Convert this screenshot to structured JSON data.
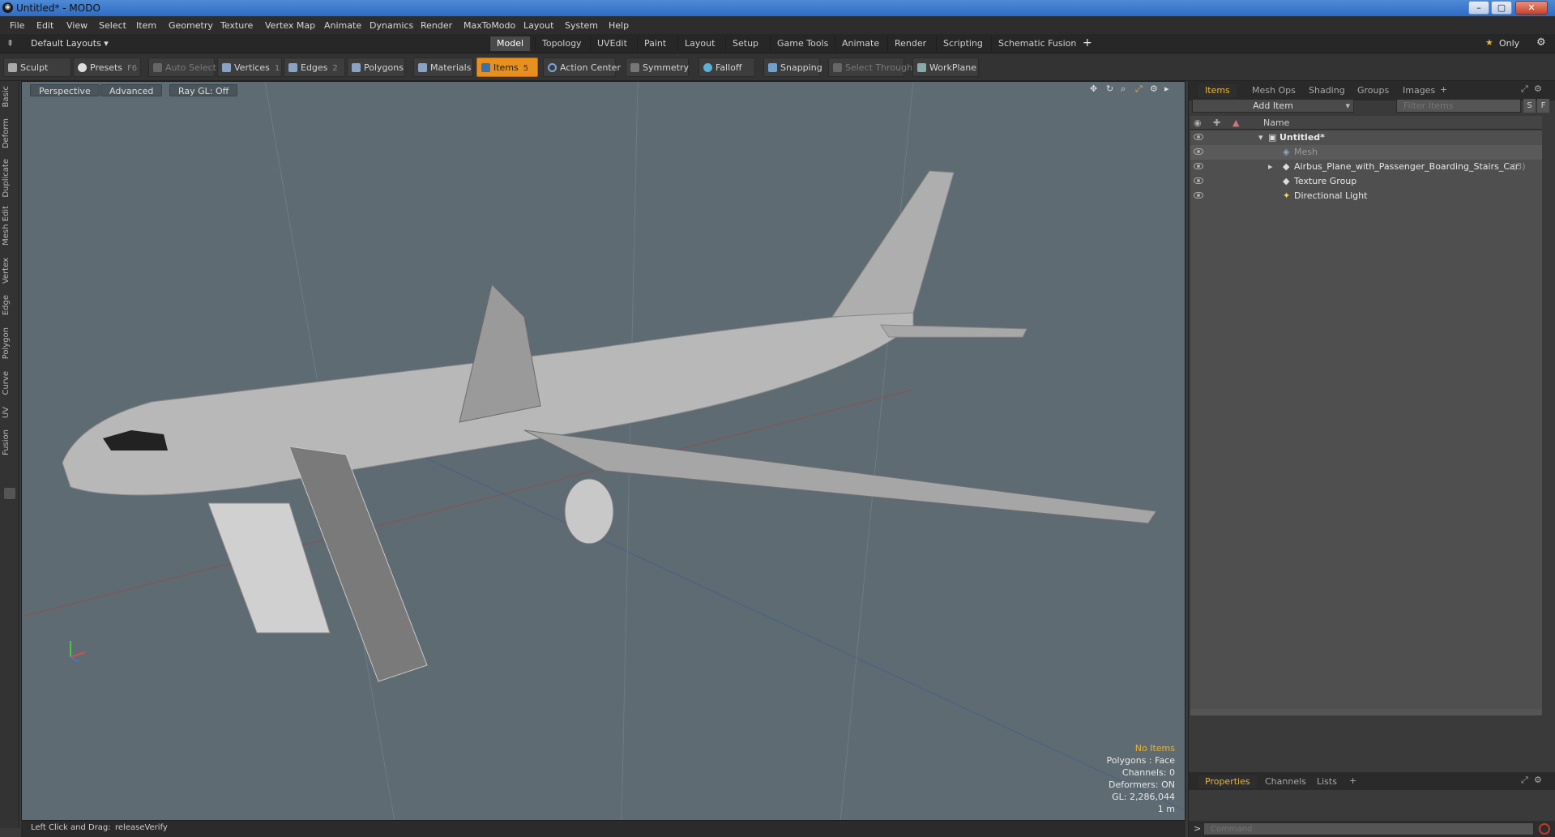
{
  "window": {
    "title": "Untitled* - MODO",
    "minimize": "–",
    "maximize": "▢",
    "close": "✕"
  },
  "menu": [
    "File",
    "Edit",
    "View",
    "Select",
    "Item",
    "Geometry",
    "Texture",
    "Vertex Map",
    "Animate",
    "Dynamics",
    "Render",
    "MaxToModo",
    "Layout",
    "System",
    "Help"
  ],
  "layout_bar": {
    "preset": "Default Layouts ▾",
    "tabs": [
      "Model",
      "Topology",
      "UVEdit",
      "Paint",
      "Layout",
      "Setup",
      "Game Tools",
      "Animate",
      "Render",
      "Scripting",
      "Schematic Fusion"
    ],
    "active_tab": "Model",
    "add": "+",
    "only_label": "Only"
  },
  "toolbar": {
    "sculpt": "Sculpt",
    "presets": "Presets",
    "presets_key": "F6",
    "auto_select": "Auto Select",
    "vertices": "Vertices",
    "vertices_key": "1",
    "edges": "Edges",
    "edges_key": "2",
    "polygons": "Polygons",
    "materials": "Materials",
    "items": "Items",
    "items_key": "5",
    "action_center": "Action Center",
    "symmetry": "Symmetry",
    "falloff": "Falloff",
    "snapping": "Snapping",
    "select_through": "Select Through",
    "workplane": "WorkPlane"
  },
  "left_tabs": [
    "Basic",
    "Deform",
    "Duplicate",
    "Mesh Edit",
    "Vertex",
    "Edge",
    "Polygon",
    "Curve",
    "UV",
    "Fusion"
  ],
  "viewport": {
    "buttons": [
      "Perspective",
      "Advanced",
      "Ray GL: Off"
    ],
    "hud": {
      "no_items": "No Items",
      "polygons": "Polygons : Face",
      "channels": "Channels: 0",
      "deformers": "Deformers: ON",
      "gl": "GL: 2,286,044",
      "scale": "1 m"
    }
  },
  "status_bar": {
    "hint_label": "Left Click and Drag:",
    "hint_value": "releaseVerify"
  },
  "right_panel": {
    "tabs": [
      "Items",
      "Mesh Ops",
      "Shading",
      "Groups",
      "Images"
    ],
    "active_tab": "Items",
    "add_item": "Add Item",
    "filter_placeholder": "Filter Items",
    "filter_s": "S",
    "filter_f": "F",
    "column_name": "Name",
    "items": [
      {
        "name": "Untitled*",
        "extra": ""
      },
      {
        "name": "Mesh",
        "extra": ""
      },
      {
        "name": "Airbus_Plane_with_Passenger_Boarding_Stairs_Car",
        "extra": "(3)"
      },
      {
        "name": "Texture Group",
        "extra": ""
      },
      {
        "name": "Directional Light",
        "extra": ""
      }
    ],
    "bottom_tabs": [
      "Properties",
      "Channels",
      "Lists"
    ],
    "bottom_active": "Properties",
    "command_prompt": ">",
    "command_placeholder": "Command"
  },
  "colors": {
    "accent": "#e8901f",
    "viewport_bg": "#5e6b72",
    "hud_warn": "#e8b53a"
  }
}
